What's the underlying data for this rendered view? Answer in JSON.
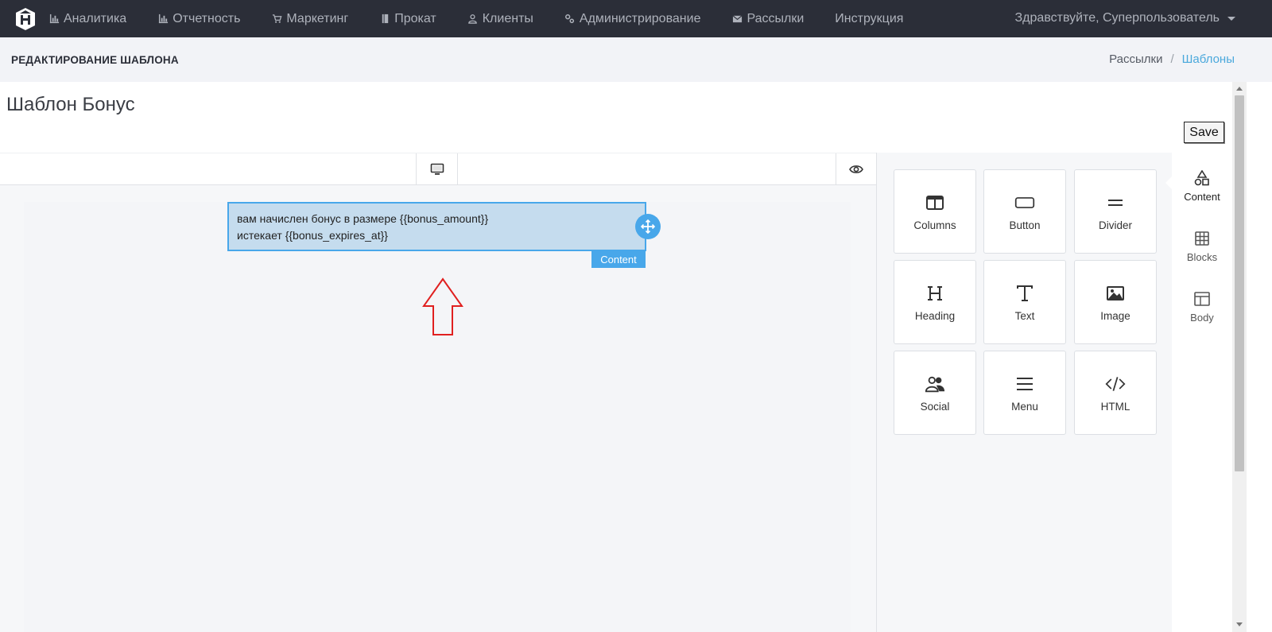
{
  "nav": {
    "items": [
      {
        "label": "Аналитика",
        "icon": "bar-chart-icon"
      },
      {
        "label": "Отчетность",
        "icon": "bar-chart-icon"
      },
      {
        "label": "Маркетинг",
        "icon": "cart-icon"
      },
      {
        "label": "Прокат",
        "icon": "book-icon"
      },
      {
        "label": "Клиенты",
        "icon": "user-icon"
      },
      {
        "label": "Администрирование",
        "icon": "gears-icon"
      },
      {
        "label": "Рассылки",
        "icon": "envelope-icon"
      },
      {
        "label": "Инструкция",
        "icon": ""
      }
    ],
    "greeting": "Здравствуйте, Суперпользователь"
  },
  "header": {
    "title": "РЕДАКТИРОВАНИЕ ШАБЛОНА",
    "breadcrumb": [
      "Рассылки",
      "Шаблоны"
    ]
  },
  "template": {
    "name": "Шаблон Бонус",
    "save_label": "Save"
  },
  "canvas": {
    "text_line1": "вам начислен бонус в размере {{bonus_amount}}",
    "text_line2": "истекает {{bonus_expires_at}}",
    "selected_tag": "Content"
  },
  "tools": [
    {
      "label": "Columns",
      "icon": "columns-icon"
    },
    {
      "label": "Button",
      "icon": "button-icon"
    },
    {
      "label": "Divider",
      "icon": "divider-icon"
    },
    {
      "label": "Heading",
      "icon": "heading-icon"
    },
    {
      "label": "Text",
      "icon": "text-icon"
    },
    {
      "label": "Image",
      "icon": "image-icon"
    },
    {
      "label": "Social",
      "icon": "social-icon"
    },
    {
      "label": "Menu",
      "icon": "menu-icon"
    },
    {
      "label": "HTML",
      "icon": "code-icon"
    }
  ],
  "tabs": [
    {
      "label": "Content",
      "icon": "shapes-icon",
      "active": true
    },
    {
      "label": "Blocks",
      "icon": "blocks-icon",
      "active": false
    },
    {
      "label": "Body",
      "icon": "body-layout-icon",
      "active": false
    }
  ],
  "colors": {
    "navbar": "#2b2e38",
    "accent": "#48a7ea",
    "selection_fill": "#c5dcee",
    "breadcrumb_active": "#4aa8dc",
    "annotation_arrow": "#e02020"
  }
}
